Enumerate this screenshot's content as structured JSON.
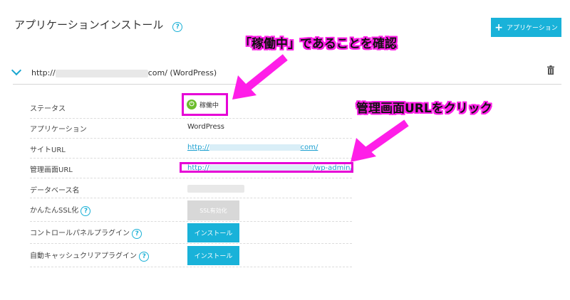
{
  "header": {
    "title": "アプリケーションインストール",
    "help_glyph": "?",
    "add_button_label": "アプリケーション",
    "add_button_icon": "plus-icon"
  },
  "app_entry": {
    "domain_prefix": "http://",
    "domain_suffix": "com/ (WordPress)"
  },
  "rows": [
    {
      "label": "ステータス",
      "value": "稼働中"
    },
    {
      "label": "アプリケーション",
      "value": "WordPress"
    },
    {
      "label": "サイトURL",
      "link_prefix": "http://",
      "link_suffix": "com/"
    },
    {
      "label": "管理画面URL",
      "link_prefix": "http://",
      "link_suffix": "/wp-admin/"
    },
    {
      "label": "データベース名"
    },
    {
      "label": "かんたんSSL化",
      "button": "SSL有効化"
    },
    {
      "label": "コントロールパネルプラグイン",
      "button": "インストール"
    },
    {
      "label": "自動キャッシュクリアプラグイン",
      "button": "インストール"
    }
  ],
  "annotations": {
    "callout_status": "「稼働中」であることを確認",
    "callout_admin": "管理画面URLをクリック"
  },
  "colors": {
    "accent": "#19b2d9",
    "highlight": "#e600d6",
    "status_green": "#6cbd2c"
  }
}
